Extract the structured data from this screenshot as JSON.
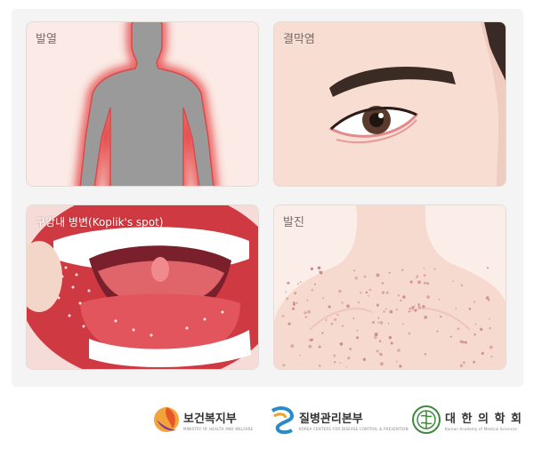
{
  "panels": {
    "fever": {
      "label": "발열"
    },
    "conjunctivitis": {
      "label": "결막염"
    },
    "oral_lesion": {
      "label": "구강내 병변(Koplik's spot)"
    },
    "rash": {
      "label": "발진"
    }
  },
  "logos": {
    "mohw": {
      "name": "보건복지부",
      "sub": "MINISTRY OF HEALTH AND WELFARE"
    },
    "kdca": {
      "name": "질병관리본부",
      "sub": "KOREA CENTERS FOR DISEASE CONTROL & PREVENTION"
    },
    "kams": {
      "name": "대 한 의 학 회",
      "sub": "Korean Academy of Medical Sciences"
    }
  },
  "colors": {
    "frame_bg": "#f4f4f4",
    "silhouette": "#9a9a9a",
    "fever_glow": "#e23a3a",
    "skin": "#f3d2c6",
    "mouth_red": "#d9414a",
    "rash_dot": "#c98a86"
  }
}
